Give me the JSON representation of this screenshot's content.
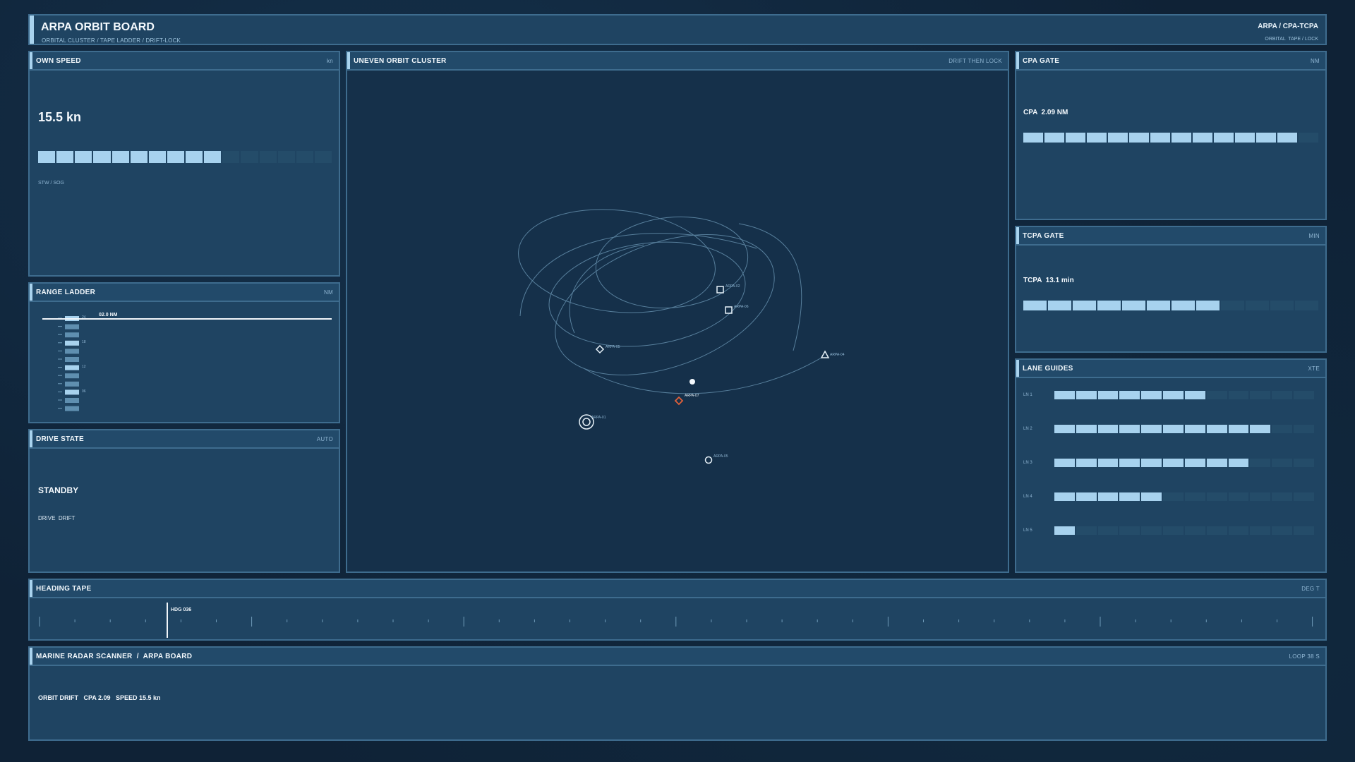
{
  "header": {
    "title": "ARPA ORBIT BOARD",
    "breadcrumbs": [
      "ORBITAL CLUSTER",
      "TAPE LADDER",
      "DRIFT-LOCK"
    ],
    "mode": "ARPA / CPA-TCPA",
    "mode_sub": "ORBITAL  TAPE / LOCK"
  },
  "own_speed": {
    "title": "OWN SPEED",
    "unit": "kn",
    "value": "15.5 kn",
    "fill_fraction": 0.62,
    "caption": "STW / SOG"
  },
  "range_ladder": {
    "title": "RANGE LADDER",
    "unit": "NM",
    "marker_label": "02.0 NM",
    "tick_labels": [
      "24",
      "18",
      "12",
      "06"
    ]
  },
  "drive_state": {
    "title": "DRIVE STATE",
    "unit": "AUTO",
    "state": "STANDBY",
    "sub": "DRIVE  DRIFT"
  },
  "orbit": {
    "title": "UNEVEN ORBIT CLUSTER",
    "tag": "DRIFT THEN LOCK",
    "targets": [
      {
        "id": "ARPA-02",
        "shape": "square"
      },
      {
        "id": "ARPA-06",
        "shape": "square"
      },
      {
        "id": "ARPA-05",
        "shape": "diamond"
      },
      {
        "id": "ARPA-04",
        "shape": "triangle"
      },
      {
        "id": "ARPA-07",
        "shape": "diamond",
        "color": "#e0603a"
      },
      {
        "id": "ARPA-01",
        "shape": "ring"
      },
      {
        "id": "ARPA-05",
        "shape": "circle"
      }
    ]
  },
  "cpa_gate": {
    "title": "CPA GATE",
    "unit": "NM",
    "label": "CPA  2.09 NM",
    "fill_fraction": 0.93
  },
  "tcpa_gate": {
    "title": "TCPA GATE",
    "unit": "MIN",
    "label": "TCPA  13.1 min",
    "fill_fraction": 0.67
  },
  "lane_guides": {
    "title": "LANE GUIDES",
    "unit": "XTE",
    "lanes": [
      {
        "label": "LN 1",
        "fill": 0.58
      },
      {
        "label": "LN 2",
        "fill": 0.83
      },
      {
        "label": "LN 3",
        "fill": 0.75
      },
      {
        "label": "LN 4",
        "fill": 0.42
      },
      {
        "label": "LN 5",
        "fill": 0.08
      }
    ]
  },
  "heading_tape": {
    "title": "HEADING TAPE",
    "unit": "DEG T",
    "marker_label": "HDG 036"
  },
  "footer": {
    "title": "MARINE RADAR SCANNER  /  ARPA BOARD",
    "tag": "LOOP 38 S",
    "status": "ORBIT DRIFT   CPA 2.09   SPEED 15.5 kn"
  },
  "colors": {
    "accent": "#a7d2ee",
    "panel": "#1f4462",
    "border": "#3e6c8e",
    "alert": "#e0603a"
  }
}
